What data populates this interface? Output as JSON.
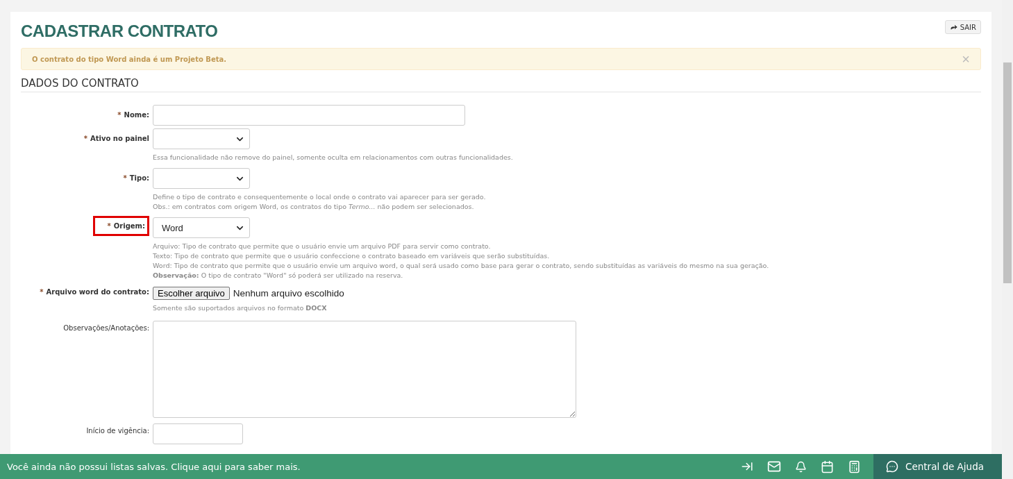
{
  "page": {
    "title": "CADASTRAR CONTRATO",
    "exit_button": "SAIR"
  },
  "alert": {
    "text": "O contrato do tipo Word ainda é um Projeto Beta.",
    "close": "×"
  },
  "section": {
    "title": "DADOS DO CONTRATO"
  },
  "required_mark": "*",
  "fields": [
    {
      "kind": "text",
      "label": "Nome:",
      "required": true,
      "highlighted": false
    },
    {
      "kind": "select",
      "label": "Ativo no painel",
      "required": true,
      "highlighted": false,
      "help": [
        "Essa funcionalidade não remove do painel, somente oculta em relacionamentos com outras funcionalidades."
      ]
    },
    {
      "kind": "select",
      "label": "Tipo:",
      "required": true,
      "highlighted": false,
      "help": [
        "Define o tipo de contrato e consequentemente o local onde o contrato vai aparecer para ser gerado.",
        "Obs.: em contratos com origem Word, os contratos do tipo *Termo...* não podem ser selecionados."
      ]
    },
    {
      "kind": "select",
      "label": "Origem:",
      "required": true,
      "highlighted": true,
      "value": "Word",
      "help": [
        "Arquivo: Tipo de contrato que permite que o usuário envie um arquivo PDF para servir como contrato.",
        "Texto: Tipo de contrato que permite que o usuário confeccione o contrato baseado em variáveis que serão substituídas.",
        "Word: Tipo de contrato que permite que o usuário envie um arquivo word, o qual será usado como base para gerar o contrato, sendo substituídas as variáveis do mesmo na sua geração.",
        "**Observação:** O tipo de contrato \"Word\" só poderá ser utilizado na reserva."
      ]
    },
    {
      "kind": "file",
      "label": "Arquivo word do contrato:",
      "required": true,
      "highlighted": false,
      "button": "Escolher arquivo",
      "status": "Nenhum arquivo escolhido",
      "help": [
        "Somente são suportados arquivos no formato **DOCX**"
      ]
    },
    {
      "kind": "textarea",
      "label": "Observações/Anotações:",
      "required": false,
      "highlighted": false
    },
    {
      "kind": "date",
      "label": "Início de vigência:",
      "required": false,
      "highlighted": false
    }
  ],
  "footer": {
    "message": "Você ainda não possui listas salvas. Clique aqui para saber mais.",
    "help_button": "Central de Ajuda"
  }
}
